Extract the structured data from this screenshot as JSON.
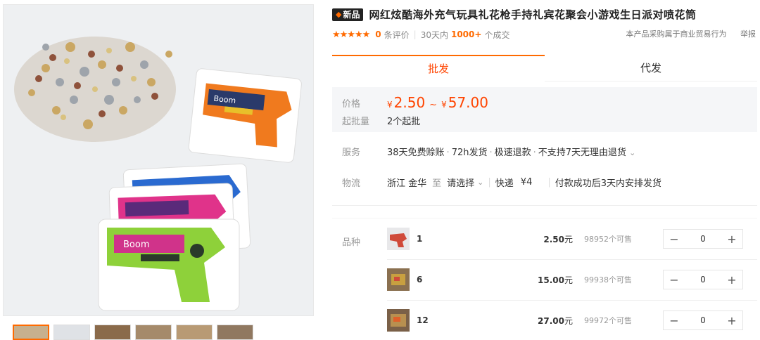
{
  "product": {
    "badge": "新品",
    "title": "网红炫酷海外充气玩具礼花枪手持礼宾花聚会小游戏生日派对喷花筒",
    "stars": "★★★★★",
    "review_count": "0",
    "review_suffix": "条评价",
    "sold_prefix": "30天内",
    "sold_count": "1000+",
    "sold_suffix": "个成交",
    "notice": "本产品采购属于商业贸易行为",
    "report": "举报"
  },
  "tabs": [
    {
      "label": "批发"
    },
    {
      "label": "代发"
    }
  ],
  "price": {
    "label": "价格",
    "currency": "¥",
    "min": "2.50",
    "separator": "~",
    "max": "57.00",
    "moq_label": "起批量",
    "moq_value": "2个起批"
  },
  "service": {
    "label": "服务",
    "items": [
      "38天免费赊账",
      "72h发货",
      "极速退款",
      "不支持7天无理由退货"
    ]
  },
  "logistics": {
    "label": "物流",
    "origin": "浙江 金华",
    "to": "至",
    "destination": "请选择",
    "method": "快递",
    "fee": "¥4",
    "note": "付款成功后3天内安排发货"
  },
  "sku": {
    "label": "品种",
    "items": [
      {
        "name": "1",
        "price": "2.50",
        "unit": "元",
        "stock": "98952个可售",
        "qty": "0"
      },
      {
        "name": "6",
        "price": "15.00",
        "unit": "元",
        "stock": "99938个可售",
        "qty": "0"
      },
      {
        "name": "12",
        "price": "27.00",
        "unit": "元",
        "stock": "99972个可售",
        "qty": "0"
      }
    ],
    "minus": "−",
    "plus": "+"
  },
  "colors": {
    "accent": "#ff6a00",
    "price": "#ff4400"
  }
}
